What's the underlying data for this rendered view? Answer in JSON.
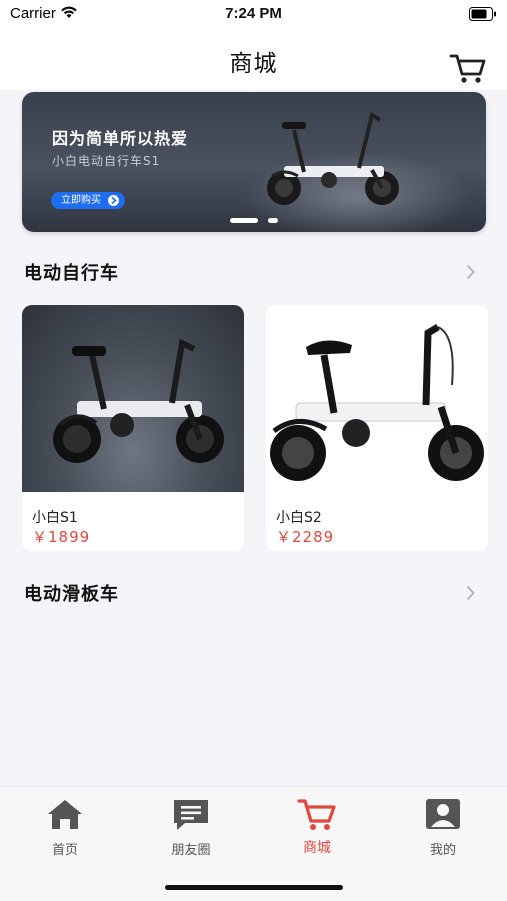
{
  "status_bar": {
    "carrier": "Carrier",
    "time": "7:24 PM"
  },
  "header": {
    "title": "商城",
    "cart_icon": "cart-icon"
  },
  "banner": {
    "title": "因为简单所以热爱",
    "subtitle": "小白电动自行车S1",
    "button_label": "立即购买",
    "brand_color": "#1f6ef2",
    "page_count": 2,
    "active_page": 1
  },
  "sections": [
    {
      "title": "电动自行车",
      "products": [
        {
          "name": "小白S1",
          "price": "￥1899",
          "image": "bike-photo-dark"
        },
        {
          "name": "小白S2",
          "price": "￥2289",
          "image": "bike-photo-white"
        }
      ]
    },
    {
      "title": "电动滑板车",
      "products": []
    }
  ],
  "tabbar": {
    "active_color": "#e0483f",
    "items": [
      {
        "label": "首页",
        "icon": "home-icon"
      },
      {
        "label": "朋友圈",
        "icon": "chat-icon"
      },
      {
        "label": "商城",
        "icon": "cart-icon",
        "active": true
      },
      {
        "label": "我的",
        "icon": "profile-icon"
      }
    ]
  }
}
